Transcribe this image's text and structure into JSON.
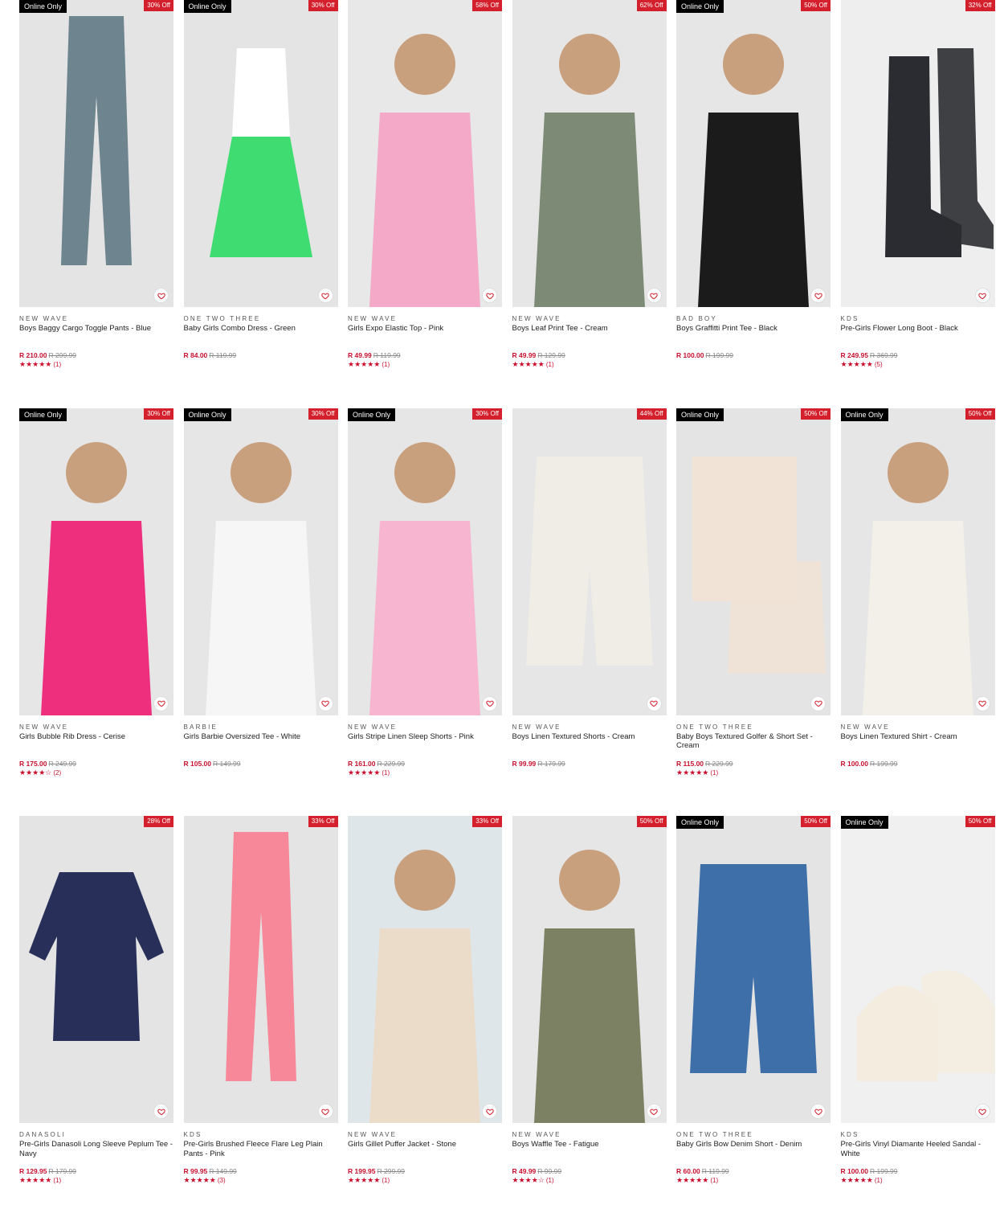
{
  "products": [
    {
      "online": "Online Only",
      "discount": "30% Off",
      "brand": "NEW WAVE",
      "name": "Boys Baggy Cargo Toggle Pants - Blue",
      "price": "R 210.00",
      "was": "R 299.99",
      "stars": "★★★★★",
      "count": "(1)",
      "bg": "#e4e4e4",
      "fg": "#6e8590",
      "shape": "pants"
    },
    {
      "online": "Online Only",
      "discount": "30% Off",
      "brand": "ONE TWO THREE",
      "name": "Baby Girls Combo Dress - Green",
      "price": "R 84.00",
      "was": "R 119.99",
      "stars": "",
      "count": "",
      "bg": "#e4e4e4",
      "fg": "#3fdc72",
      "shape": "dress"
    },
    {
      "online": "",
      "discount": "58% Off",
      "brand": "NEW WAVE",
      "name": "Girls Expo Elastic Top - Pink",
      "price": "R 49.99",
      "was": "R 119.99",
      "stars": "★★★★★",
      "count": "(1)",
      "bg": "#e8e8e8",
      "fg": "#f3a9c7",
      "shape": "model"
    },
    {
      "online": "",
      "discount": "62% Off",
      "brand": "NEW WAVE",
      "name": "Boys Leaf Print Tee - Cream",
      "price": "R 49.99",
      "was": "R 129.99",
      "stars": "★★★★★",
      "count": "(1)",
      "bg": "#e6e6e6",
      "fg": "#7d8b76",
      "shape": "model"
    },
    {
      "online": "Online Only",
      "discount": "50% Off",
      "brand": "BAD BOY",
      "name": "Boys Graffitti Print Tee - Black",
      "price": "R 100.00",
      "was": "R 199.99",
      "stars": "",
      "count": "",
      "bg": "#e6e6e6",
      "fg": "#1b1b1b",
      "shape": "model"
    },
    {
      "online": "",
      "discount": "32% Off",
      "brand": "KDS",
      "name": "Pre-Girls Flower Long Boot - Black",
      "price": "R 249.95",
      "was": "R 369.99",
      "stars": "★★★★★",
      "count": "(5)",
      "bg": "#eeeeee",
      "fg": "#2a2c31",
      "shape": "boots"
    },
    {
      "online": "Online Only",
      "discount": "30% Off",
      "brand": "NEW WAVE",
      "name": "Girls Bubble Rib Dress - Cerise",
      "price": "R 175.00",
      "was": "R 249.99",
      "stars": "★★★★☆",
      "count": "(2)",
      "bg": "#e6e6e6",
      "fg": "#ee2f7e",
      "shape": "model"
    },
    {
      "online": "Online Only",
      "discount": "30% Off",
      "brand": "BARBIE",
      "name": "Girls Barbie Oversized Tee - White",
      "price": "R 105.00",
      "was": "R 149.99",
      "stars": "",
      "count": "",
      "bg": "#e6e6e6",
      "fg": "#f6f6f6",
      "shape": "model"
    },
    {
      "online": "Online Only",
      "discount": "30% Off",
      "brand": "NEW WAVE",
      "name": "Girls Stripe Linen Sleep Shorts - Pink",
      "price": "R 161.00",
      "was": "R 229.99",
      "stars": "★★★★★",
      "count": "(1)",
      "bg": "#e6e6e6",
      "fg": "#f7b5cf",
      "shape": "model"
    },
    {
      "online": "",
      "discount": "44% Off",
      "brand": "NEW WAVE",
      "name": "Boys Linen Textured Shorts - Cream",
      "price": "R 99.99",
      "was": "R 179.99",
      "stars": "",
      "count": "",
      "bg": "#e6e6e6",
      "fg": "#efede6",
      "shape": "shorts"
    },
    {
      "online": "Online Only",
      "discount": "50% Off",
      "brand": "ONE TWO THREE",
      "name": "Baby Boys Textured Golfer & Short Set - Cream",
      "price": "R 115.00",
      "was": "R 229.99",
      "stars": "★★★★★",
      "count": "(1)",
      "bg": "#e4e4e4",
      "fg": "#f1e3d6",
      "shape": "set"
    },
    {
      "online": "Online Only",
      "discount": "50% Off",
      "brand": "NEW WAVE",
      "name": "Boys Linen Textured Shirt - Cream",
      "price": "R 100.00",
      "was": "R 199.99",
      "stars": "",
      "count": "",
      "bg": "#e6e6e6",
      "fg": "#f2f0e8",
      "shape": "model"
    },
    {
      "online": "",
      "discount": "28% Off",
      "brand": "DANASOLI",
      "name": "Pre-Girls Danasoli Long Sleeve Peplum Tee - Navy",
      "price": "R 129.95",
      "was": "R 179.99",
      "stars": "★★★★★",
      "count": "(1)",
      "bg": "#e4e4e4",
      "fg": "#28305a",
      "shape": "top"
    },
    {
      "online": "",
      "discount": "33% Off",
      "brand": "KDS",
      "name": "Pre-Girls Brushed Fleece Flare Leg Plain Pants - Pink",
      "price": "R 99.95",
      "was": "R 149.99",
      "stars": "★★★★★",
      "count": "(3)",
      "bg": "#e4e4e4",
      "fg": "#f7889a",
      "shape": "pants"
    },
    {
      "online": "",
      "discount": "33% Off",
      "brand": "NEW WAVE",
      "name": "Girls Gillet Puffer Jacket - Stone",
      "price": "R 199.95",
      "was": "R 299.99",
      "stars": "★★★★★",
      "count": "(1)",
      "bg": "#dfe6ea",
      "fg": "#eadcc8",
      "shape": "model"
    },
    {
      "online": "",
      "discount": "50% Off",
      "brand": "NEW WAVE",
      "name": "Boys Waffle Tee - Fatigue",
      "price": "R 49.99",
      "was": "R 99.99",
      "stars": "★★★★☆",
      "count": "(1)",
      "bg": "#e6e6e6",
      "fg": "#7c8163",
      "shape": "model"
    },
    {
      "online": "Online Only",
      "discount": "50% Off",
      "brand": "ONE TWO THREE",
      "name": "Baby Girls Bow Denim Short - Denim",
      "price": "R 60.00",
      "was": "R 119.99",
      "stars": "★★★★★",
      "count": "(1)",
      "bg": "#e4e4e4",
      "fg": "#3f6fa8",
      "shape": "shorts"
    },
    {
      "online": "Online Only",
      "discount": "50% Off",
      "brand": "KDS",
      "name": "Pre-Girls Vinyl Diamante Heeled Sandal - White",
      "price": "R 100.00",
      "was": "R 199.99",
      "stars": "★★★★★",
      "count": "(1)",
      "bg": "#f0f0f0",
      "fg": "#f4ecdf",
      "shape": "sandal"
    }
  ]
}
